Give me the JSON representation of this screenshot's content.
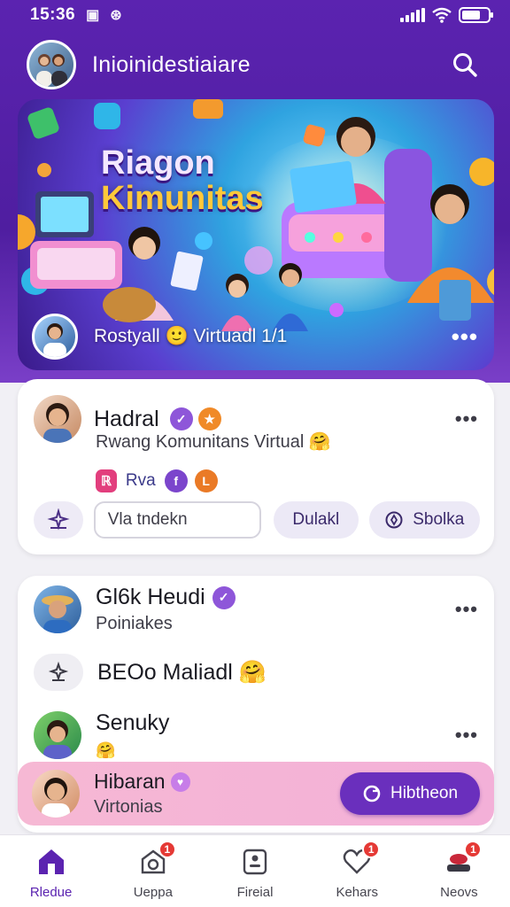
{
  "status": {
    "time": "15:36",
    "icons": [
      "media-icon",
      "notification-icon"
    ]
  },
  "header": {
    "title": "Inioinidestiaiare"
  },
  "banner": {
    "title_line1": "Riagon",
    "title_line2": "Kimunitas",
    "caption": "Rostyall 🙂 Virtuadl 1/1",
    "more": "•••"
  },
  "post": {
    "name": "Hadral",
    "subtitle": "Rwang Komunitans Virtual 🤗",
    "chips": [
      "ℝ",
      "Rva",
      "f",
      "L"
    ],
    "input_placeholder": "Vla tndekn",
    "button1": "Dulakl",
    "button2": "Sbolka",
    "more": "•••"
  },
  "list": {
    "item1": {
      "name": "Gl6k Heudi",
      "subtitle": "Poiniakes",
      "more": "•••"
    },
    "item2": {
      "text": "BEOo Maliadl 🤗"
    },
    "item3": {
      "name": "Senuky",
      "emoji": "🤗",
      "more": "•••"
    }
  },
  "highlight": {
    "name": "Hibaran",
    "subtitle": "Virtonias",
    "button": "Hibtheon"
  },
  "nav": {
    "items": [
      {
        "label": "Rledue",
        "badge": ""
      },
      {
        "label": "Ueppa",
        "badge": "1"
      },
      {
        "label": "Fireial",
        "badge": ""
      },
      {
        "label": "Kehars",
        "badge": "1"
      },
      {
        "label": "Neovs",
        "badge": "1"
      }
    ]
  },
  "colors": {
    "primary": "#5b23b0",
    "accent": "#6a2fbd",
    "badge": "#e53935",
    "highlight": "#f6b8d4"
  }
}
